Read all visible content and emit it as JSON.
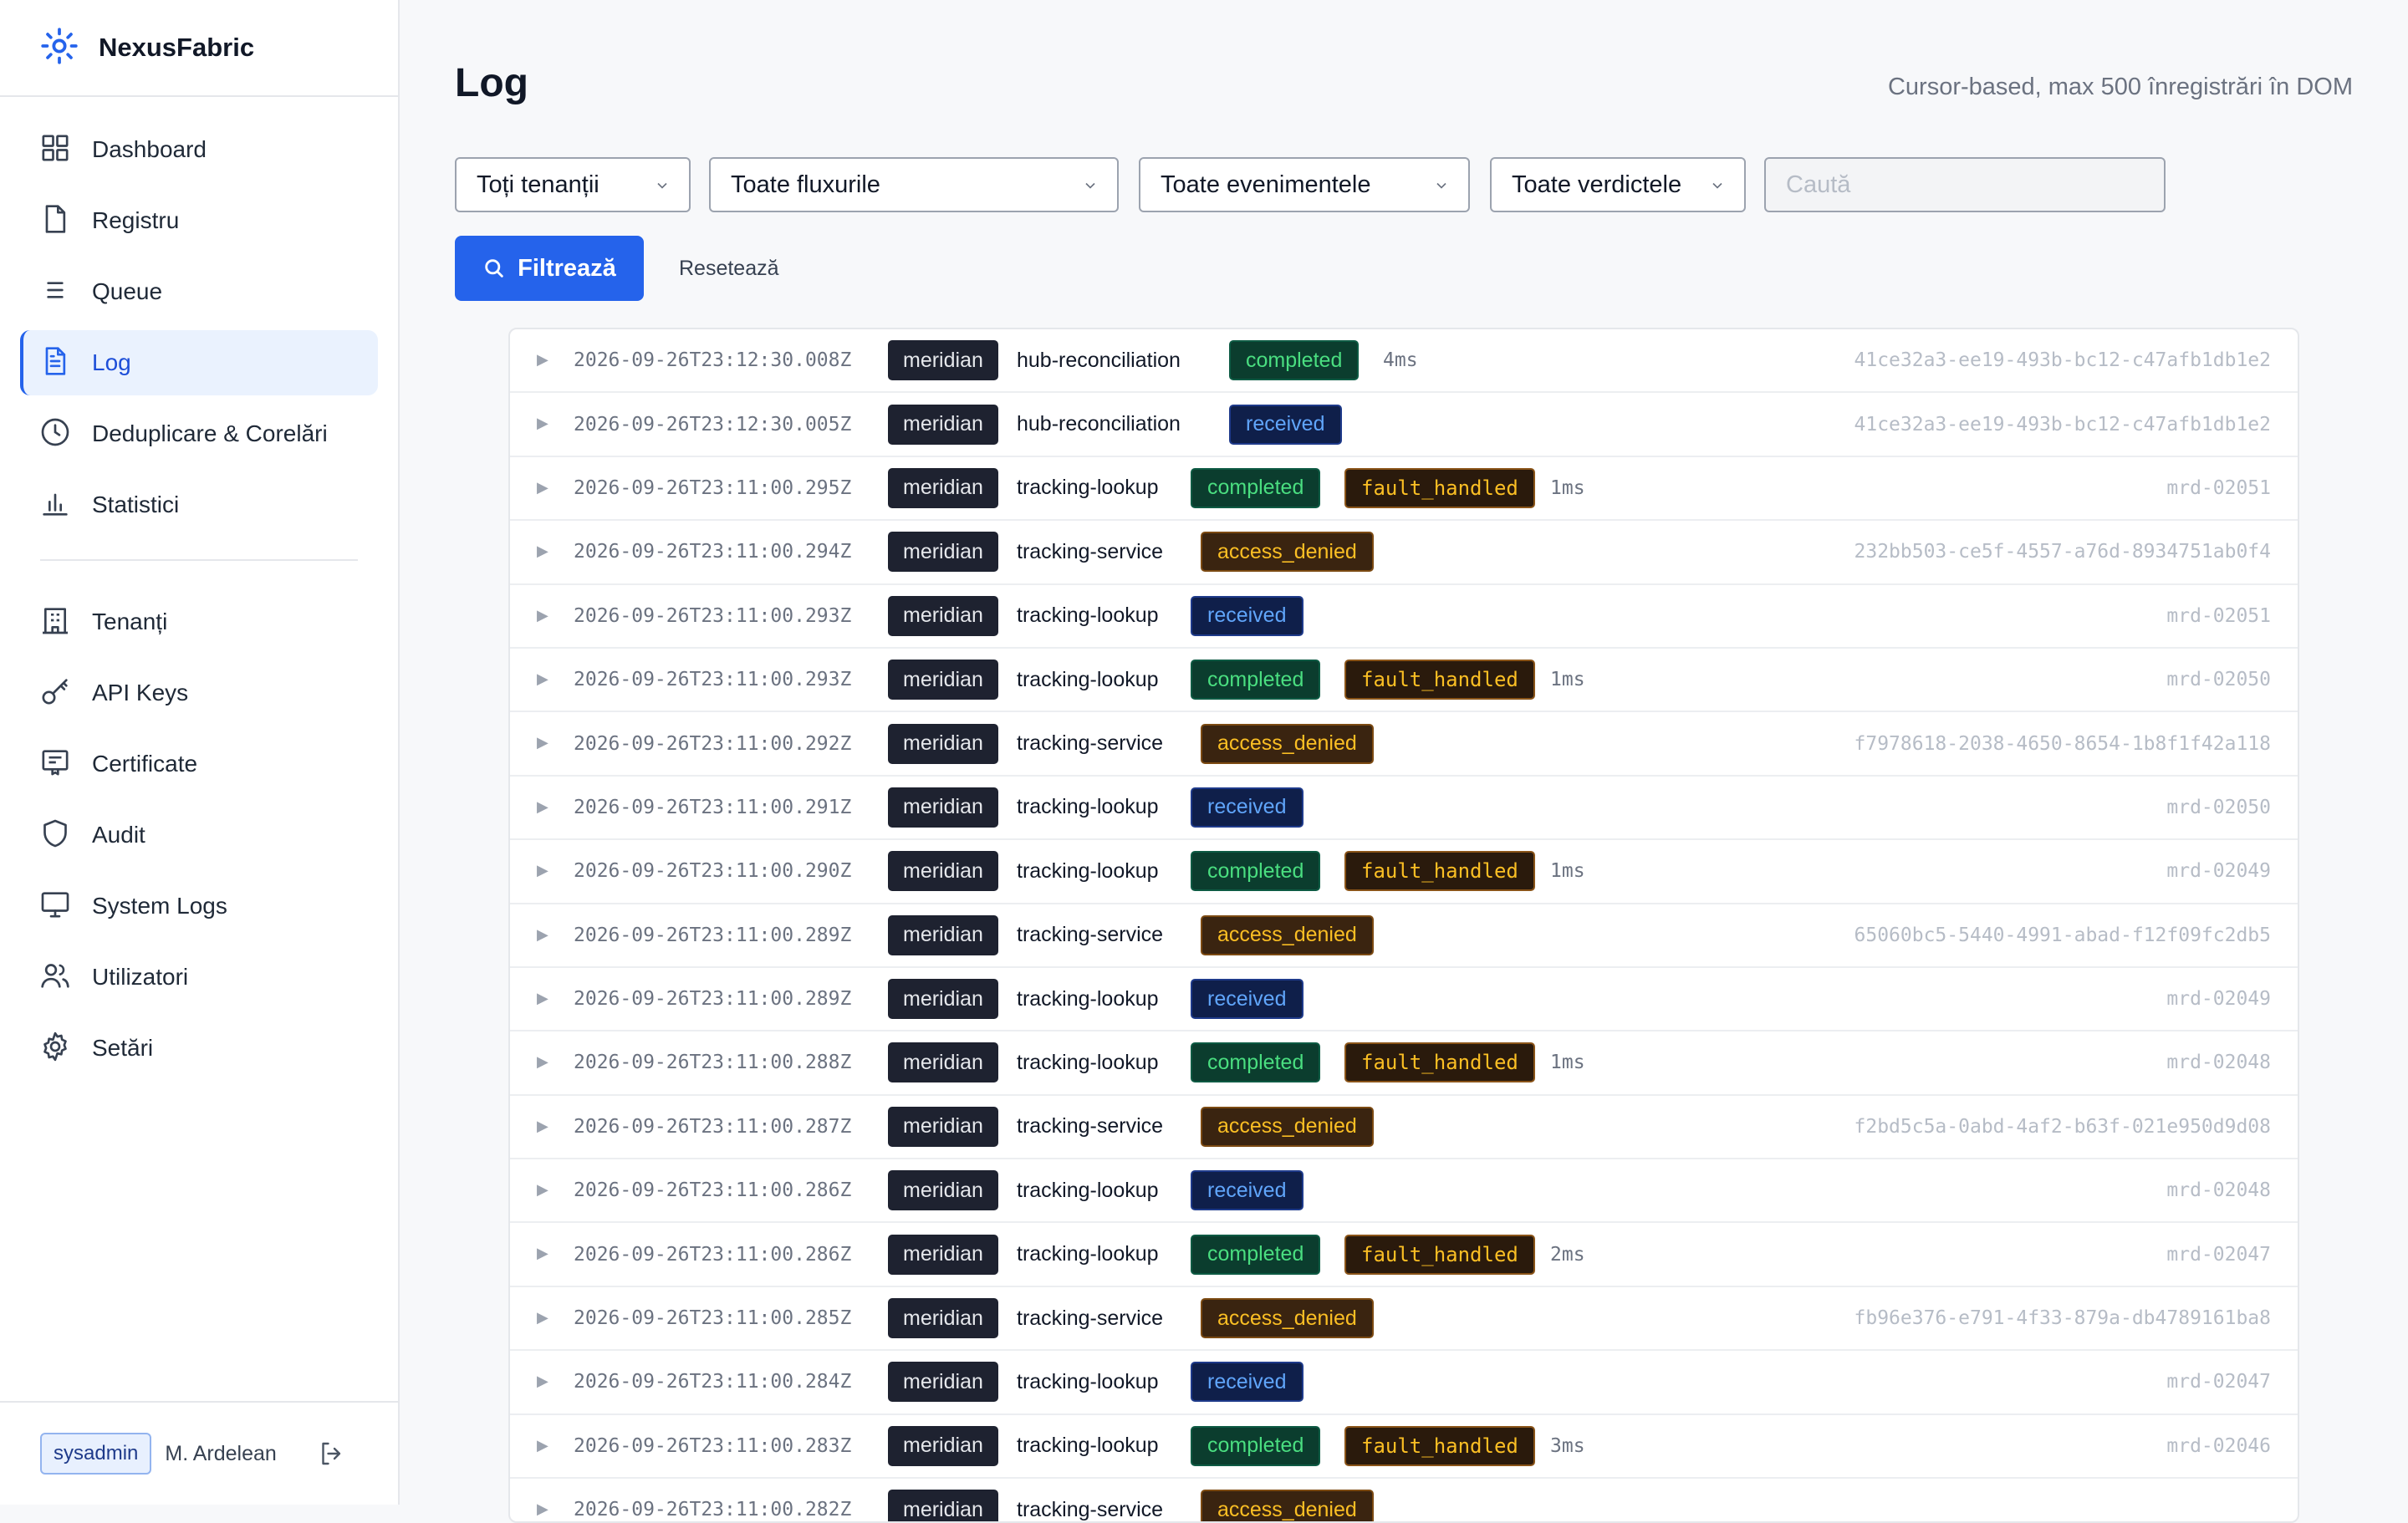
{
  "brand": {
    "name": "NexusFabric",
    "icon": "sun-cog-icon",
    "accent": "#2563eb"
  },
  "nav": {
    "items": [
      {
        "label": "Dashboard",
        "icon": "grid-icon"
      },
      {
        "label": "Registru",
        "icon": "file-icon"
      },
      {
        "label": "Queue",
        "icon": "list-icon"
      },
      {
        "label": "Log",
        "icon": "file-text-icon",
        "active": true
      },
      {
        "label": "Deduplicare & Corelări",
        "icon": "clock-icon"
      },
      {
        "label": "Statistici",
        "icon": "bar-chart-icon"
      },
      {
        "label": "Tenanți",
        "icon": "building-icon"
      },
      {
        "label": "API Keys",
        "icon": "key-icon"
      },
      {
        "label": "Certificate",
        "icon": "certificate-icon"
      },
      {
        "label": "Audit",
        "icon": "shield-icon"
      },
      {
        "label": "System Logs",
        "icon": "monitor-icon"
      },
      {
        "label": "Utilizatori",
        "icon": "users-icon"
      },
      {
        "label": "Setări",
        "icon": "gear-icon"
      }
    ]
  },
  "footer": {
    "role": "sysadmin",
    "user": "M. Ardelean",
    "logout_icon": "logout-icon"
  },
  "page": {
    "title": "Log",
    "note": "Cursor-based, max 500 înregistrări în DOM"
  },
  "filters": {
    "tenant": "Toți tenanții",
    "flow": "Toate fluxurile",
    "event": "Toate evenimentele",
    "verdict": "Toate verdictele",
    "search_placeholder": "Caută",
    "search_value": "",
    "filter_label": "Filtrează",
    "reset_label": "Resetează"
  },
  "status_colors": {
    "completed": "#4ade80",
    "received": "#60a5fa",
    "access_denied": "#fbbf24",
    "fault_handled": "#fbbf24"
  },
  "log_rows": [
    {
      "ts": "2026-09-26T23:12:30.008Z",
      "tenant": "meridian",
      "flow": "hub-reconciliation",
      "event": "completed",
      "verdict": "",
      "duration": "4ms",
      "correlation": "41ce32a3-ee19-493b-bc12-c47afb1db1e2"
    },
    {
      "ts": "2026-09-26T23:12:30.005Z",
      "tenant": "meridian",
      "flow": "hub-reconciliation",
      "event": "received",
      "verdict": "",
      "duration": "",
      "correlation": "41ce32a3-ee19-493b-bc12-c47afb1db1e2"
    },
    {
      "ts": "2026-09-26T23:11:00.295Z",
      "tenant": "meridian",
      "flow": "tracking-lookup",
      "event": "completed",
      "verdict": "fault_handled",
      "duration": "1ms",
      "correlation": "mrd-02051"
    },
    {
      "ts": "2026-09-26T23:11:00.294Z",
      "tenant": "meridian",
      "flow": "tracking-service",
      "event": "access_denied",
      "verdict": "",
      "duration": "",
      "correlation": "232bb503-ce5f-4557-a76d-8934751ab0f4"
    },
    {
      "ts": "2026-09-26T23:11:00.293Z",
      "tenant": "meridian",
      "flow": "tracking-lookup",
      "event": "received",
      "verdict": "",
      "duration": "",
      "correlation": "mrd-02051"
    },
    {
      "ts": "2026-09-26T23:11:00.293Z",
      "tenant": "meridian",
      "flow": "tracking-lookup",
      "event": "completed",
      "verdict": "fault_handled",
      "duration": "1ms",
      "correlation": "mrd-02050"
    },
    {
      "ts": "2026-09-26T23:11:00.292Z",
      "tenant": "meridian",
      "flow": "tracking-service",
      "event": "access_denied",
      "verdict": "",
      "duration": "",
      "correlation": "f7978618-2038-4650-8654-1b8f1f42a118"
    },
    {
      "ts": "2026-09-26T23:11:00.291Z",
      "tenant": "meridian",
      "flow": "tracking-lookup",
      "event": "received",
      "verdict": "",
      "duration": "",
      "correlation": "mrd-02050"
    },
    {
      "ts": "2026-09-26T23:11:00.290Z",
      "tenant": "meridian",
      "flow": "tracking-lookup",
      "event": "completed",
      "verdict": "fault_handled",
      "duration": "1ms",
      "correlation": "mrd-02049"
    },
    {
      "ts": "2026-09-26T23:11:00.289Z",
      "tenant": "meridian",
      "flow": "tracking-service",
      "event": "access_denied",
      "verdict": "",
      "duration": "",
      "correlation": "65060bc5-5440-4991-abad-f12f09fc2db5"
    },
    {
      "ts": "2026-09-26T23:11:00.289Z",
      "tenant": "meridian",
      "flow": "tracking-lookup",
      "event": "received",
      "verdict": "",
      "duration": "",
      "correlation": "mrd-02049"
    },
    {
      "ts": "2026-09-26T23:11:00.288Z",
      "tenant": "meridian",
      "flow": "tracking-lookup",
      "event": "completed",
      "verdict": "fault_handled",
      "duration": "1ms",
      "correlation": "mrd-02048"
    },
    {
      "ts": "2026-09-26T23:11:00.287Z",
      "tenant": "meridian",
      "flow": "tracking-service",
      "event": "access_denied",
      "verdict": "",
      "duration": "",
      "correlation": "f2bd5c5a-0abd-4af2-b63f-021e950d9d08"
    },
    {
      "ts": "2026-09-26T23:11:00.286Z",
      "tenant": "meridian",
      "flow": "tracking-lookup",
      "event": "received",
      "verdict": "",
      "duration": "",
      "correlation": "mrd-02048"
    },
    {
      "ts": "2026-09-26T23:11:00.286Z",
      "tenant": "meridian",
      "flow": "tracking-lookup",
      "event": "completed",
      "verdict": "fault_handled",
      "duration": "2ms",
      "correlation": "mrd-02047"
    },
    {
      "ts": "2026-09-26T23:11:00.285Z",
      "tenant": "meridian",
      "flow": "tracking-service",
      "event": "access_denied",
      "verdict": "",
      "duration": "",
      "correlation": "fb96e376-e791-4f33-879a-db4789161ba8"
    },
    {
      "ts": "2026-09-26T23:11:00.284Z",
      "tenant": "meridian",
      "flow": "tracking-lookup",
      "event": "received",
      "verdict": "",
      "duration": "",
      "correlation": "mrd-02047"
    },
    {
      "ts": "2026-09-26T23:11:00.283Z",
      "tenant": "meridian",
      "flow": "tracking-lookup",
      "event": "completed",
      "verdict": "fault_handled",
      "duration": "3ms",
      "correlation": "mrd-02046"
    },
    {
      "ts": "2026-09-26T23:11:00.282Z",
      "tenant": "meridian",
      "flow": "tracking-service",
      "event": "access_denied",
      "verdict": "",
      "duration": "",
      "correlation": ""
    }
  ]
}
